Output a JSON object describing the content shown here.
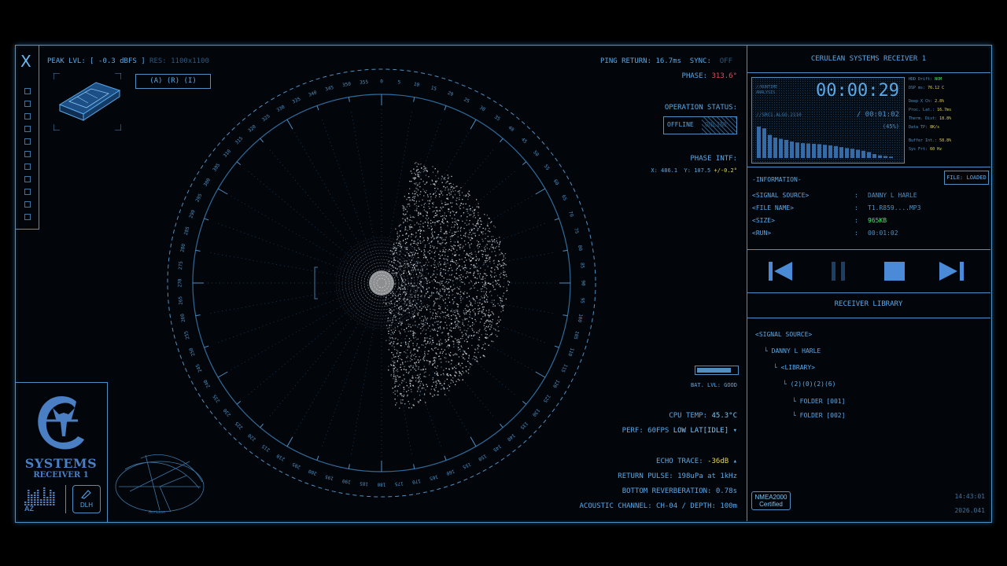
{
  "header": {
    "close_label": "X",
    "peak_label": "PEAK LVL: [ -0.3 dBFS ]",
    "res_label": "RES: 1100x1100",
    "axis_buttons": "(A) (R) (I)",
    "ping_return": "PING RETURN: 16.7ms",
    "sync_label": "SYNC:",
    "sync_value": "OFF",
    "phase_label": "PHASE:",
    "phase_value": "313.6°",
    "operation_status_label": "OPERATION STATUS:",
    "offline_label": "OFFLINE",
    "online_label": "ONLINE",
    "phase_intf_label": "PHASE INTF:",
    "phase_intf_x": "X: 486.1",
    "phase_intf_y": "Y: 107.5",
    "phase_intf_delta": "+/-0.2°"
  },
  "status": {
    "bat_label": "BAT. LVL: GOOD",
    "bat_level": 0.85,
    "cpu_label": "CPU TEMP:",
    "cpu_value": "45.3°C",
    "perf_label": "PERF: 60FPS",
    "perf_mode": "LOW LAT[IDLE]",
    "echo_label": "ECHO TRACE:",
    "echo_value": "-36dB",
    "return_pulse": "RETURN PULSE: 198uPa at 1kHz",
    "bottom_reverb": "BOTTOM REVERBERATION: 0.78s",
    "acoustic_channel": "ACOUSTIC CHANNEL: CH-04 / DEPTH: 100m"
  },
  "dial": {
    "outer_labels": [
      "330",
      "335",
      "340",
      "345",
      "350",
      "355",
      "0",
      "5",
      "10",
      "15",
      "20",
      "25",
      "30",
      "35",
      "40",
      "45",
      "50",
      "55",
      "60",
      "65",
      "70",
      "75",
      "80",
      "85",
      "90",
      "95",
      "100",
      "105",
      "110",
      "115",
      "120",
      "125",
      "130",
      "135",
      "140",
      "145",
      "150",
      "155",
      "160",
      "165",
      "170",
      "175",
      "180",
      "185",
      "190",
      "195",
      "200",
      "205",
      "210",
      "215",
      "220",
      "225",
      "230",
      "235",
      "240",
      "245",
      "250",
      "255",
      "260",
      "265",
      "270",
      "275",
      "280",
      "285",
      "290",
      "295",
      "300",
      "305",
      "310",
      "315",
      "320",
      "325"
    ]
  },
  "logo": {
    "line1": "SYSTEMS",
    "line2": "RECEIVER 1",
    "brand": "AZ",
    "initials": "DLH",
    "horizon_label": "Horizon"
  },
  "right_panel": {
    "title": "CERULEAN SYSTEMS RECEIVER 1",
    "screen": {
      "tag1": "//RUNTIME",
      "tag1b": "ANALYSIS",
      "time_main": "00:00:29",
      "tag2": "//SRC1.ALGO.2110",
      "time_total": "/ 00:01:02",
      "percent": "(45%)",
      "bars": [
        0.95,
        0.9,
        0.7,
        0.62,
        0.58,
        0.55,
        0.5,
        0.47,
        0.45,
        0.44,
        0.43,
        0.42,
        0.4,
        0.38,
        0.36,
        0.33,
        0.3,
        0.28,
        0.25,
        0.22,
        0.18,
        0.12,
        0.08,
        0.06,
        0.04
      ]
    },
    "stats": [
      {
        "label": "HDD Drift:",
        "value": "NOM"
      },
      {
        "label": "DSP ms:",
        "value": "76.12 C"
      },
      {
        "label": "Deep X Ch:",
        "value": "2.8%"
      },
      {
        "label": "Proc. Lat.:",
        "value": "16.7ms"
      },
      {
        "label": "Therm. Dist:",
        "value": "18.8%"
      },
      {
        "label": "Data TP:",
        "value": "8K/s"
      },
      {
        "label": "Buffer Int.:",
        "value": "58.8%"
      },
      {
        "label": "Sys Frt:",
        "value": "60 Hz"
      }
    ],
    "file_status": "FILE: LOADED",
    "info_title": "-INFORMATION-",
    "info_rows": [
      {
        "key": "<SIGNAL SOURCE>",
        "sep": ":",
        "value": "DANNY L HARLE"
      },
      {
        "key": "<FILE NAME>",
        "sep": ":",
        "value": "T1.R859....MP3"
      },
      {
        "key": "<SIZE>",
        "sep": ":",
        "value": "965KB"
      },
      {
        "key": "<RUN>",
        "sep": ":",
        "value": "00:01:02"
      }
    ],
    "library_title": "RECEIVER LIBRARY",
    "tree": [
      "<SIGNAL SOURCE>",
      "DANNY L HARLE",
      "<LIBRARY>",
      "(2)(0)(2)(6)",
      "FOLDER [001]",
      "FOLDER [002]"
    ],
    "cert_line1": "NMEA2000",
    "cert_line2": "Certified",
    "clock_time": "14:43:01",
    "clock_date": "2026.041"
  },
  "colors": {
    "accent": "#5aa8e6",
    "frame": "#4f8fc2",
    "warning": "#e24a5a",
    "highlight": "#e6d34a",
    "ok": "#4ee06a"
  }
}
